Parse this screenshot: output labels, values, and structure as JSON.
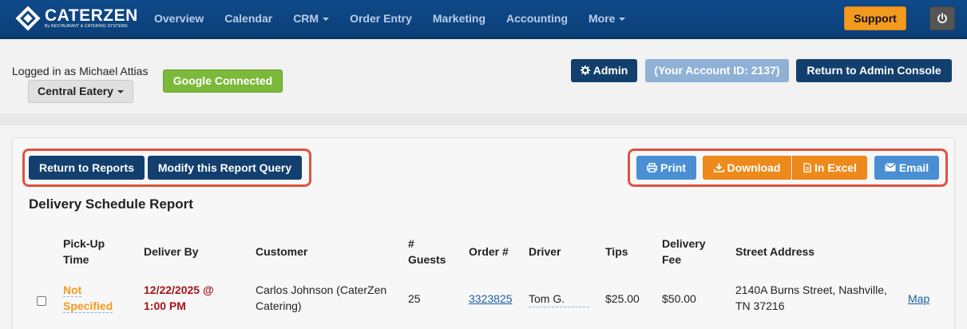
{
  "brand": {
    "name": "CATERZEN",
    "tagline": "By RESTAURANT & CATERING SYSTEMS"
  },
  "nav": {
    "items": [
      {
        "label": "Overview"
      },
      {
        "label": "Calendar"
      },
      {
        "label": "CRM"
      },
      {
        "label": "Order Entry"
      },
      {
        "label": "Marketing"
      },
      {
        "label": "Accounting"
      },
      {
        "label": "More"
      }
    ],
    "support_label": "Support"
  },
  "header": {
    "logged_in_text": "Logged in as Michael Attias",
    "location_label": "Central Eatery",
    "google_label": "Google Connected",
    "admin_label": "Admin",
    "account_label": "(Your Account ID: 2137)",
    "console_label": "Return to Admin Console"
  },
  "report": {
    "return_label": "Return to Reports",
    "modify_label": "Modify this Report Query",
    "print_label": "Print",
    "download_label": "Download",
    "excel_label": "In Excel",
    "email_label": "Email",
    "title": "Delivery Schedule Report",
    "columns": {
      "pickup_1": "Pick-Up",
      "pickup_2": "Time",
      "deliver_by": "Deliver By",
      "customer": "Customer",
      "guests_1": "#",
      "guests_2": "Guests",
      "order": "Order #",
      "driver": "Driver",
      "tips": "Tips",
      "fee_1": "Delivery",
      "fee_2": "Fee",
      "address": "Street Address"
    },
    "rows": [
      {
        "pickup_1": "Not",
        "pickup_2": "Specified",
        "deliver_1": "12/22/2025 @",
        "deliver_2": "1:00 PM",
        "customer_1": "Carlos Johnson (CaterZen",
        "customer_2": "Catering)",
        "guests": "25",
        "order": "3323825",
        "driver": "Tom G.",
        "tips": "$25.00",
        "fee": "$50.00",
        "address_1": "2140A Burns Street, Nashville,",
        "address_2": "TN 37216",
        "map_label": "Map"
      }
    ]
  },
  "colors": {
    "nav_bg": "#0f4a8a",
    "support": "#f39a1e",
    "google": "#7cb93a",
    "dark_button": "#133f6e",
    "light_blue_button": "#4a8fd3",
    "orange_button": "#ee8a1c",
    "highlight": "#e0533f",
    "deliver_text": "#a5151a"
  }
}
